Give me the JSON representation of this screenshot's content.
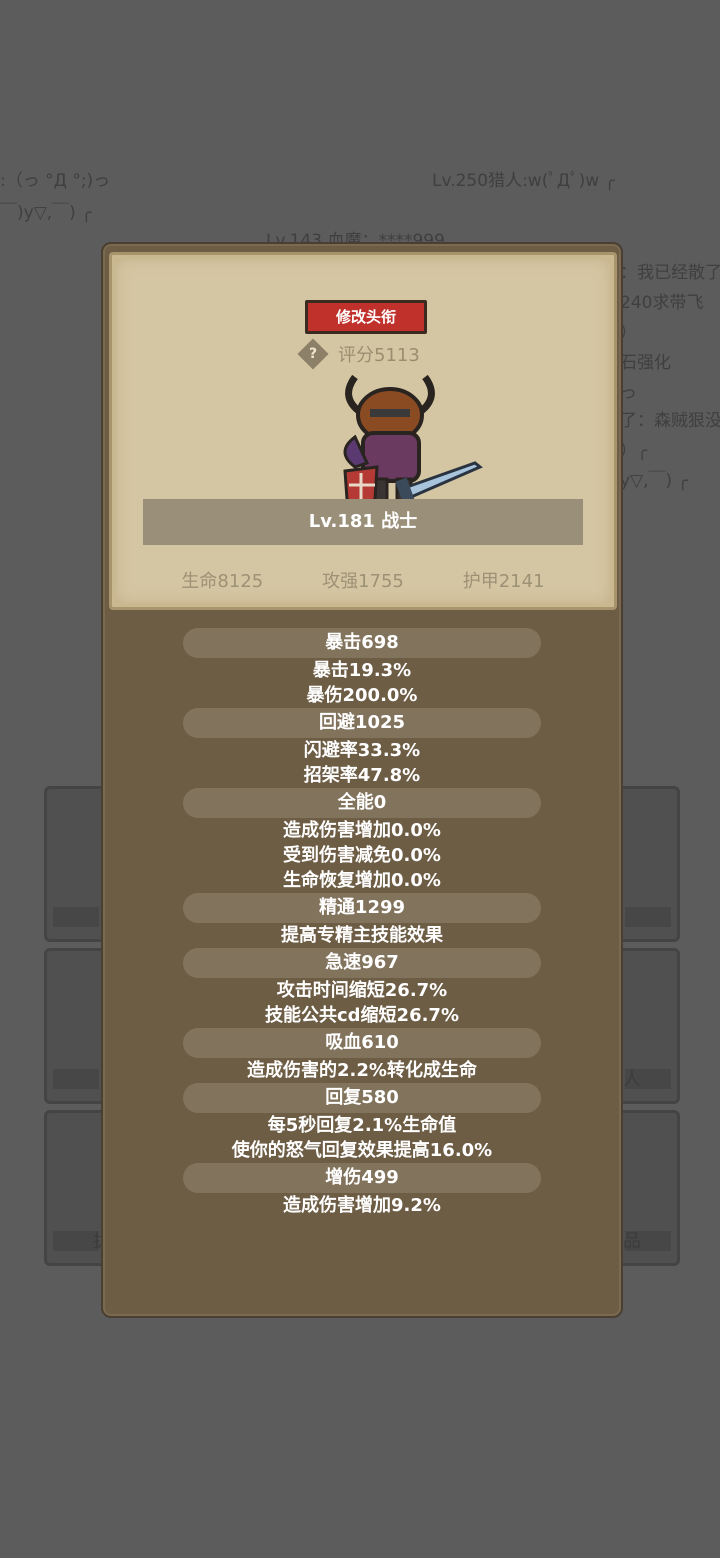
{
  "background": {
    "chat_lines": [
      ":（っ °Д °;)っ",
      "Lv.250猎人:w(ﾟДﾟ)w ╭",
      "￣)y▽,￣) ╭",
      "Lv.143 血魔：****999",
      "：我已经散了",
      "240求带飞",
      "）",
      "石强化",
      "っ",
      "了：森贼狠没",
      "）╭",
      "y▽,￣) ╭"
    ],
    "slot_labels": [
      "人",
      "拢",
      "品"
    ]
  },
  "character": {
    "rename_label": "修改头衔",
    "help_symbol": "?",
    "score": "评分5113",
    "name": "Lv.181 战士",
    "stats": [
      "生命8125",
      "攻强1755",
      "护甲2141"
    ]
  },
  "attributes": {
    "crit_header": "暴击698",
    "crit_lines": [
      "暴击19.3%",
      "暴伤200.0%"
    ],
    "dodge_header": "回避1025",
    "dodge_lines": [
      "闪避率33.3%",
      "招架率47.8%"
    ],
    "versatility_header": "全能0",
    "versatility_lines": [
      "造成伤害增加0.0%",
      "受到伤害减免0.0%",
      "生命恢复增加0.0%"
    ],
    "mastery_header": "精通1299",
    "mastery_lines": [
      "提高专精主技能效果"
    ],
    "haste_header": "急速967",
    "haste_lines": [
      "攻击时间缩短26.7%",
      "技能公共cd缩短26.7%"
    ],
    "leech_header": "吸血610",
    "leech_lines": [
      "造成伤害的2.2%转化成生命"
    ],
    "regen_header": "回复580",
    "regen_lines": [
      "每5秒回复2.1%生命值",
      "使你的怒气回复效果提高16.0%"
    ],
    "damage_header": "增伤499",
    "damage_lines": [
      "造成伤害增加9.2%"
    ]
  }
}
